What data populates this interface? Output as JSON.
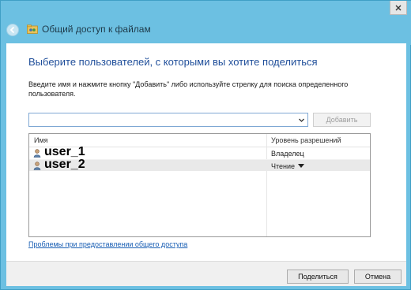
{
  "window": {
    "title": "Общий доступ к файлам"
  },
  "main": {
    "heading": "Выберите пользователей, с которыми вы хотите поделиться",
    "instruction": "Введите имя и нажмите кнопку \"Добавить\" либо используйте стрелку для поиска определенного пользователя.",
    "user_input_value": "",
    "add_button_label": "Добавить"
  },
  "list": {
    "header_name": "Имя",
    "header_permission": "Уровень разрешений",
    "rows": [
      {
        "name": "user_1",
        "permission": "Владелец"
      },
      {
        "name": "user_2",
        "permission": "Чтение"
      }
    ]
  },
  "help_link": "Проблемы при предоставлении общего доступа",
  "footer": {
    "share_label": "Поделиться",
    "cancel_label": "Отмена"
  },
  "colors": {
    "title_bar": "#6cc0e2",
    "heading_text": "#1f4e9a",
    "link": "#1a5fb4"
  },
  "icons": [
    "back-arrow-icon",
    "shared-folder-icon",
    "close-icon",
    "chevron-down-icon",
    "user-icon"
  ]
}
